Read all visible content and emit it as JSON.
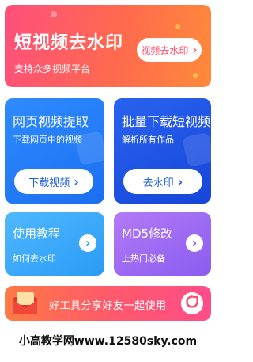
{
  "hero": {
    "title": "短视频去水印",
    "subtitle": "支持众多视频平台",
    "button_label": "视频去水印",
    "arrow": "›"
  },
  "cards": {
    "web_video": {
      "title": "网页视频提取",
      "desc": "下载网页中的视频",
      "button_label": "下载视频",
      "arrow": "›"
    },
    "batch": {
      "title": "批量下载短视频",
      "desc": "解析所有作品",
      "button_label": "去水印",
      "arrow": "›"
    },
    "tutorial": {
      "title": "使用教程",
      "desc": "如何去水印",
      "arrow": "›"
    },
    "md5": {
      "title": "MD5修改",
      "desc": "上热门必备",
      "arrow": "›"
    }
  },
  "banner": {
    "text": "好工具分享好友一起使用"
  },
  "footer": {
    "text": "小高教学网www.12580sky.com"
  },
  "colors": {
    "hero_button_text": "#ff4f6e",
    "blue_button_text": "#1d5fe0",
    "circle_arrow_cyan": "#2a9bf5",
    "circle_arrow_purple": "#8a5cf0"
  }
}
